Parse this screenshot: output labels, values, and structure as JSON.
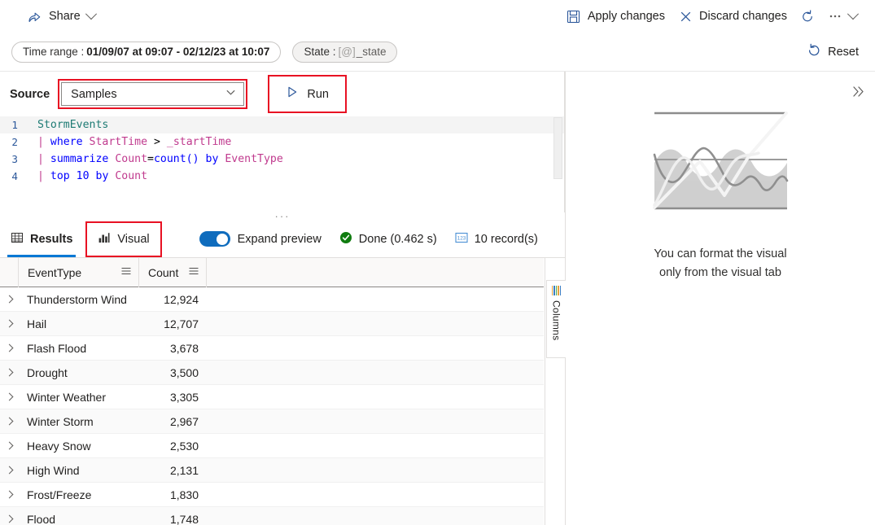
{
  "commandbar": {
    "share": {
      "label": "Share",
      "icon": "share-icon",
      "caret": "chevron-down-icon"
    },
    "apply": {
      "label": "Apply changes",
      "icon": "save-icon"
    },
    "discard": {
      "label": "Discard changes",
      "icon": "close-icon"
    },
    "refresh": {
      "icon": "refresh-icon"
    },
    "overflow": {
      "label": "···",
      "icon": "more-icon",
      "caret": "chevron-down-icon"
    }
  },
  "pillbar": {
    "time_range": {
      "label": "Time range :",
      "value": "01/09/07 at 09:07 - 02/12/23 at 10:07"
    },
    "state": {
      "label": "State :",
      "value_prefix": "[@]",
      "value": "_state"
    },
    "reset": {
      "label": "Reset",
      "icon": "reset-icon"
    }
  },
  "query": {
    "source_label": "Source",
    "source_value": "Samples",
    "source_options": [
      "Samples"
    ],
    "run_label": "Run",
    "run_icon": "play-icon",
    "lines": [
      {
        "n": "1",
        "tokens": [
          {
            "t": "StormEvents",
            "c": "tok-tbl"
          }
        ]
      },
      {
        "n": "2",
        "tokens": [
          {
            "t": "| ",
            "c": "tok-pipe"
          },
          {
            "t": "where",
            "c": "tok-kw"
          },
          {
            "t": " ",
            "c": "tok-plain"
          },
          {
            "t": "StartTime",
            "c": "tok-col"
          },
          {
            "t": " ",
            "c": "tok-plain"
          },
          {
            "t": ">",
            "c": "tok-op"
          },
          {
            "t": " ",
            "c": "tok-plain"
          },
          {
            "t": "_startTime",
            "c": "tok-var"
          }
        ]
      },
      {
        "n": "3",
        "tokens": [
          {
            "t": "| ",
            "c": "tok-pipe"
          },
          {
            "t": "summarize",
            "c": "tok-kw"
          },
          {
            "t": " ",
            "c": "tok-plain"
          },
          {
            "t": "Count",
            "c": "tok-col"
          },
          {
            "t": "=",
            "c": "tok-op"
          },
          {
            "t": "count()",
            "c": "tok-fn"
          },
          {
            "t": " ",
            "c": "tok-plain"
          },
          {
            "t": "by",
            "c": "tok-kw"
          },
          {
            "t": " ",
            "c": "tok-plain"
          },
          {
            "t": "EventType",
            "c": "tok-col"
          }
        ]
      },
      {
        "n": "4",
        "tokens": [
          {
            "t": "| ",
            "c": "tok-pipe"
          },
          {
            "t": "top",
            "c": "tok-kw"
          },
          {
            "t": " ",
            "c": "tok-plain"
          },
          {
            "t": "10",
            "c": "tok-num"
          },
          {
            "t": " ",
            "c": "tok-plain"
          },
          {
            "t": "by",
            "c": "tok-kw"
          },
          {
            "t": " ",
            "c": "tok-plain"
          },
          {
            "t": "Count",
            "c": "tok-col"
          }
        ]
      }
    ]
  },
  "results": {
    "tabs": [
      {
        "label": "Results",
        "icon": "table-icon",
        "selected": true,
        "highlighted": false
      },
      {
        "label": "Visual",
        "icon": "chart-icon",
        "selected": false,
        "highlighted": true
      }
    ],
    "expand_preview_label": "Expand preview",
    "expand_preview_on": true,
    "status_label": "Done (0.462 s)",
    "status_icon": "check-circle-icon",
    "records_label": "10 record(s)",
    "records_icon": "number-type-icon",
    "columns_tab_label": "Columns",
    "columns_tab_icon": "columns-icon",
    "table": {
      "headers": [
        "EventType",
        "Count"
      ],
      "header_menu_icon": "column-menu-icon",
      "row_expand_icon": "chevron-right-icon",
      "rows": [
        {
          "EventType": "Thunderstorm Wind",
          "Count": "12,924"
        },
        {
          "EventType": "Hail",
          "Count": "12,707"
        },
        {
          "EventType": "Flash Flood",
          "Count": "3,678"
        },
        {
          "EventType": "Drought",
          "Count": "3,500"
        },
        {
          "EventType": "Winter Weather",
          "Count": "3,305"
        },
        {
          "EventType": "Winter Storm",
          "Count": "2,967"
        },
        {
          "EventType": "Heavy Snow",
          "Count": "2,530"
        },
        {
          "EventType": "High Wind",
          "Count": "2,131"
        },
        {
          "EventType": "Frost/Freeze",
          "Count": "1,830"
        },
        {
          "EventType": "Flood",
          "Count": "1,748"
        }
      ]
    }
  },
  "visual_panel": {
    "collapse_icon": "double-chevron-right-icon",
    "empty_art_icon": "chart-placeholder-illustration",
    "empty_message_line1": "You can format the visual",
    "empty_message_line2": "only from the visual tab"
  },
  "colors": {
    "accent": "#0078d4",
    "toggle_on": "#0f6cbd",
    "annotation_red": "#e81123",
    "success_green": "#107c10"
  }
}
